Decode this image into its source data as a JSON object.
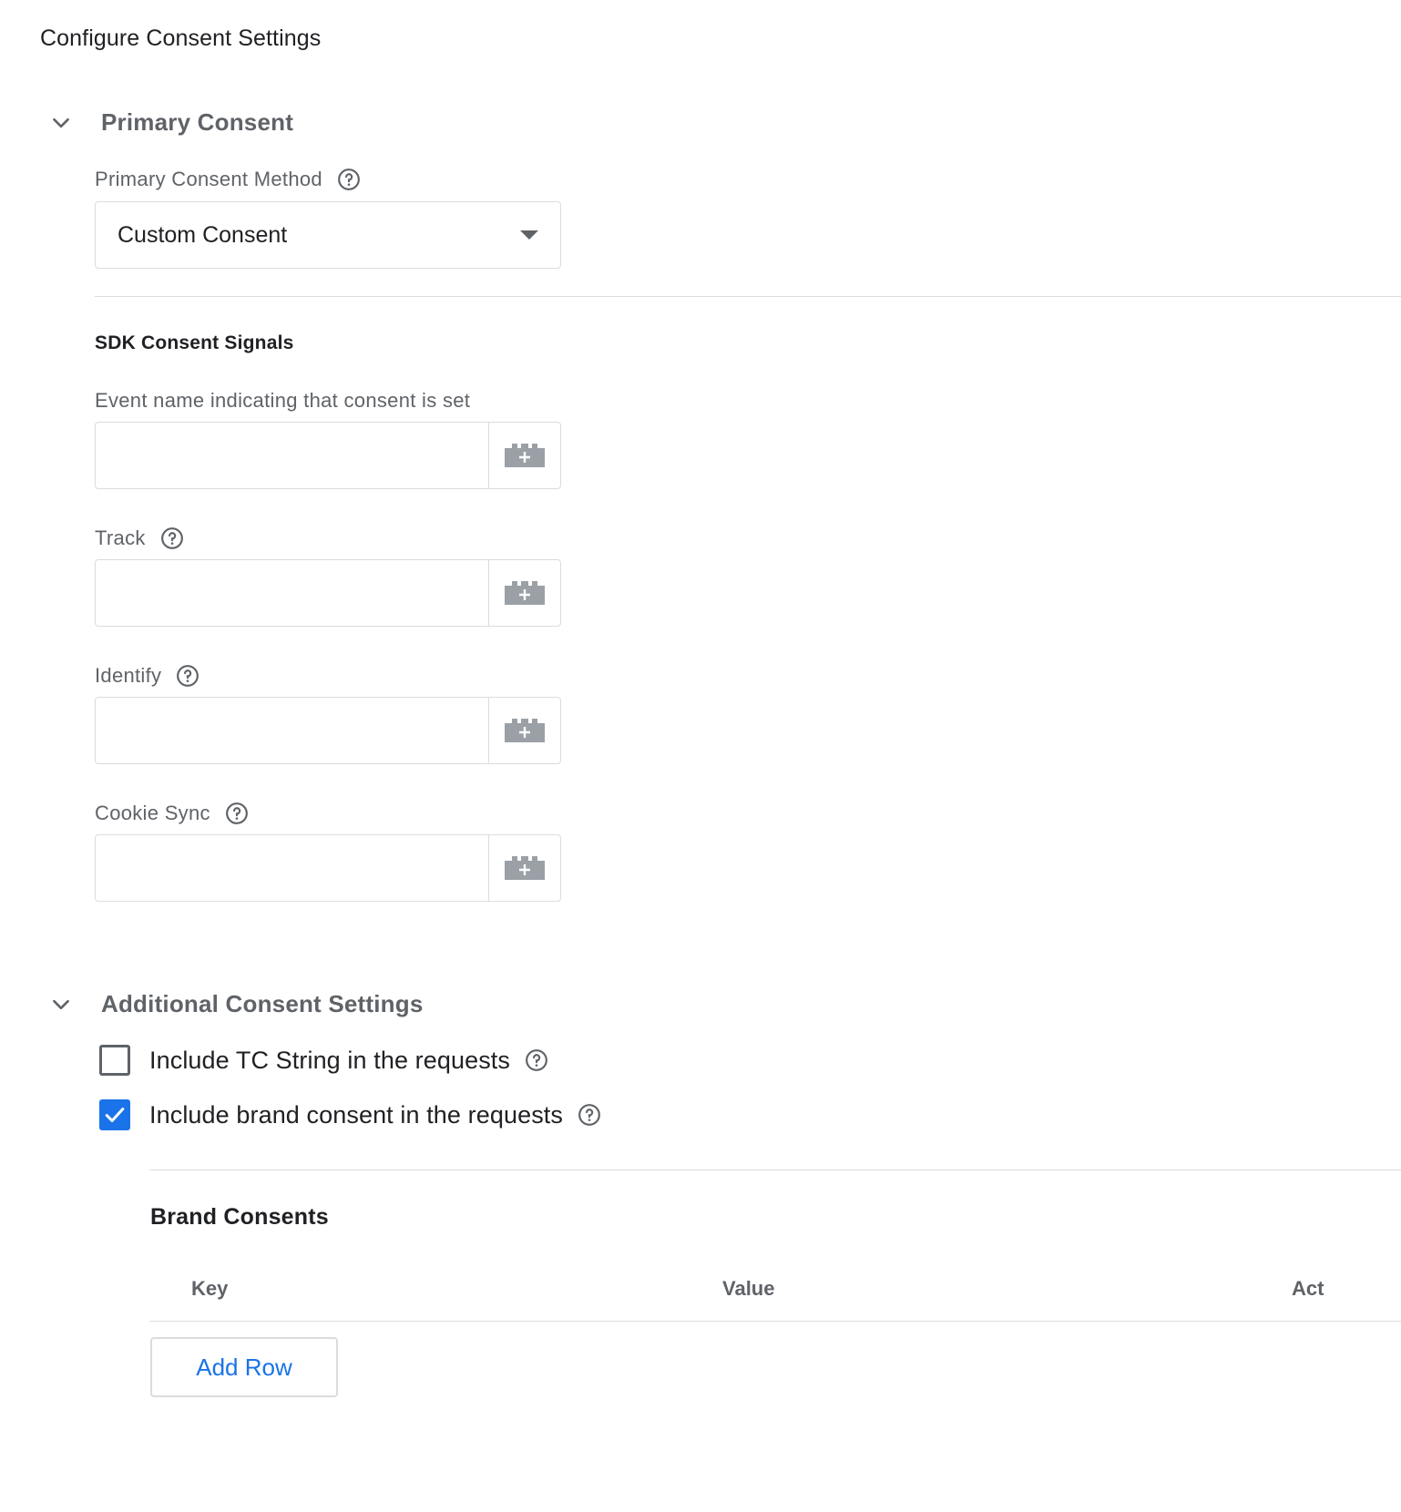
{
  "page": {
    "title": "Configure Consent Settings"
  },
  "primary": {
    "section_title": "Primary Consent",
    "method_label": "Primary Consent Method",
    "method_value": "Custom Consent"
  },
  "sdk": {
    "heading": "SDK Consent Signals",
    "fields": [
      {
        "label": "Event name indicating that consent is set",
        "value": "",
        "has_help": false
      },
      {
        "label": "Track",
        "value": "",
        "has_help": true
      },
      {
        "label": "Identify",
        "value": "",
        "has_help": true
      },
      {
        "label": "Cookie Sync",
        "value": "",
        "has_help": true
      }
    ]
  },
  "additional": {
    "section_title": "Additional Consent Settings",
    "checkboxes": [
      {
        "label": "Include TC String in the requests",
        "checked": false
      },
      {
        "label": "Include brand consent in the requests",
        "checked": true
      }
    ]
  },
  "brand": {
    "heading": "Brand Consents",
    "columns": [
      "Key",
      "Value",
      "Act"
    ],
    "add_row_label": "Add Row"
  },
  "icons": {
    "chevron": "chevron-down-icon",
    "help": "help-circle-icon",
    "variable": "add-variable-icon",
    "caret": "dropdown-caret-icon"
  },
  "colors": {
    "accent": "#1a73e8",
    "muted_text": "#5f6368",
    "border": "#dadce0"
  }
}
